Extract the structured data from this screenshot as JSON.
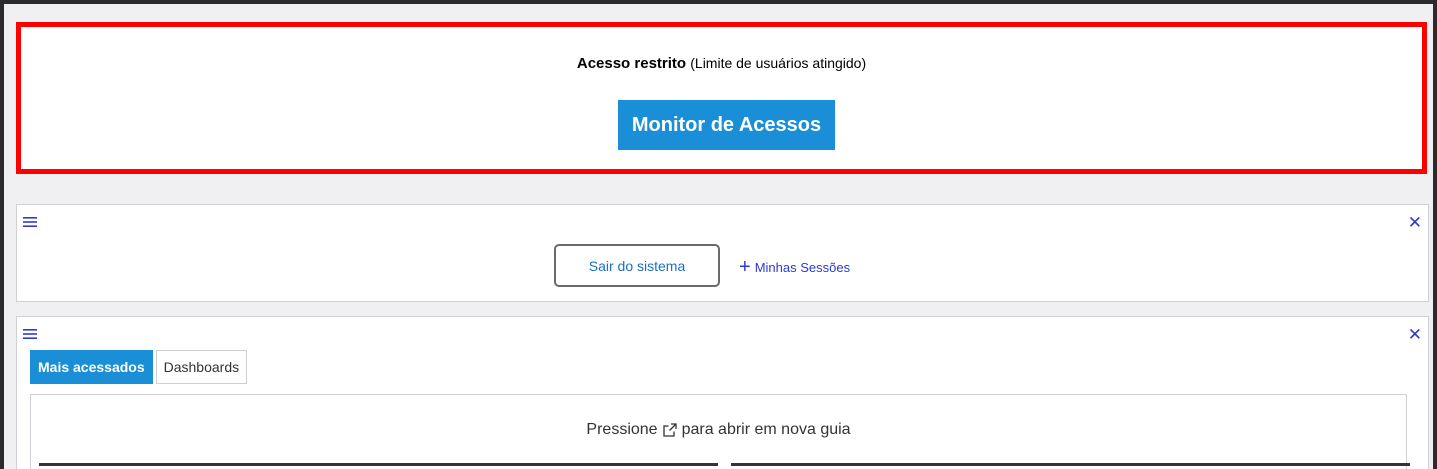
{
  "alert": {
    "title": "Acesso restrito",
    "subtitle": "(Limite de usuários atingido)",
    "button_label": "Monitor de Acessos",
    "border_color": "#ff0000"
  },
  "session_panel": {
    "menu_icon": "hamburger-icon",
    "close_icon": "close-icon",
    "logout_label": "Sair do sistema",
    "sessions_label": "Minhas Sessões",
    "sessions_icon": "plus-icon"
  },
  "shortcuts_panel": {
    "menu_icon": "hamburger-icon",
    "close_icon": "close-icon",
    "tabs": [
      {
        "label": "Mais acessados",
        "active": true
      },
      {
        "label": "Dashboards",
        "active": false
      }
    ],
    "hint_before": "Pressione",
    "hint_icon": "external-link-icon",
    "hint_after": "para abrir em nova guia"
  },
  "colors": {
    "accent": "#1a8ed6",
    "link": "#2d3ad6"
  }
}
